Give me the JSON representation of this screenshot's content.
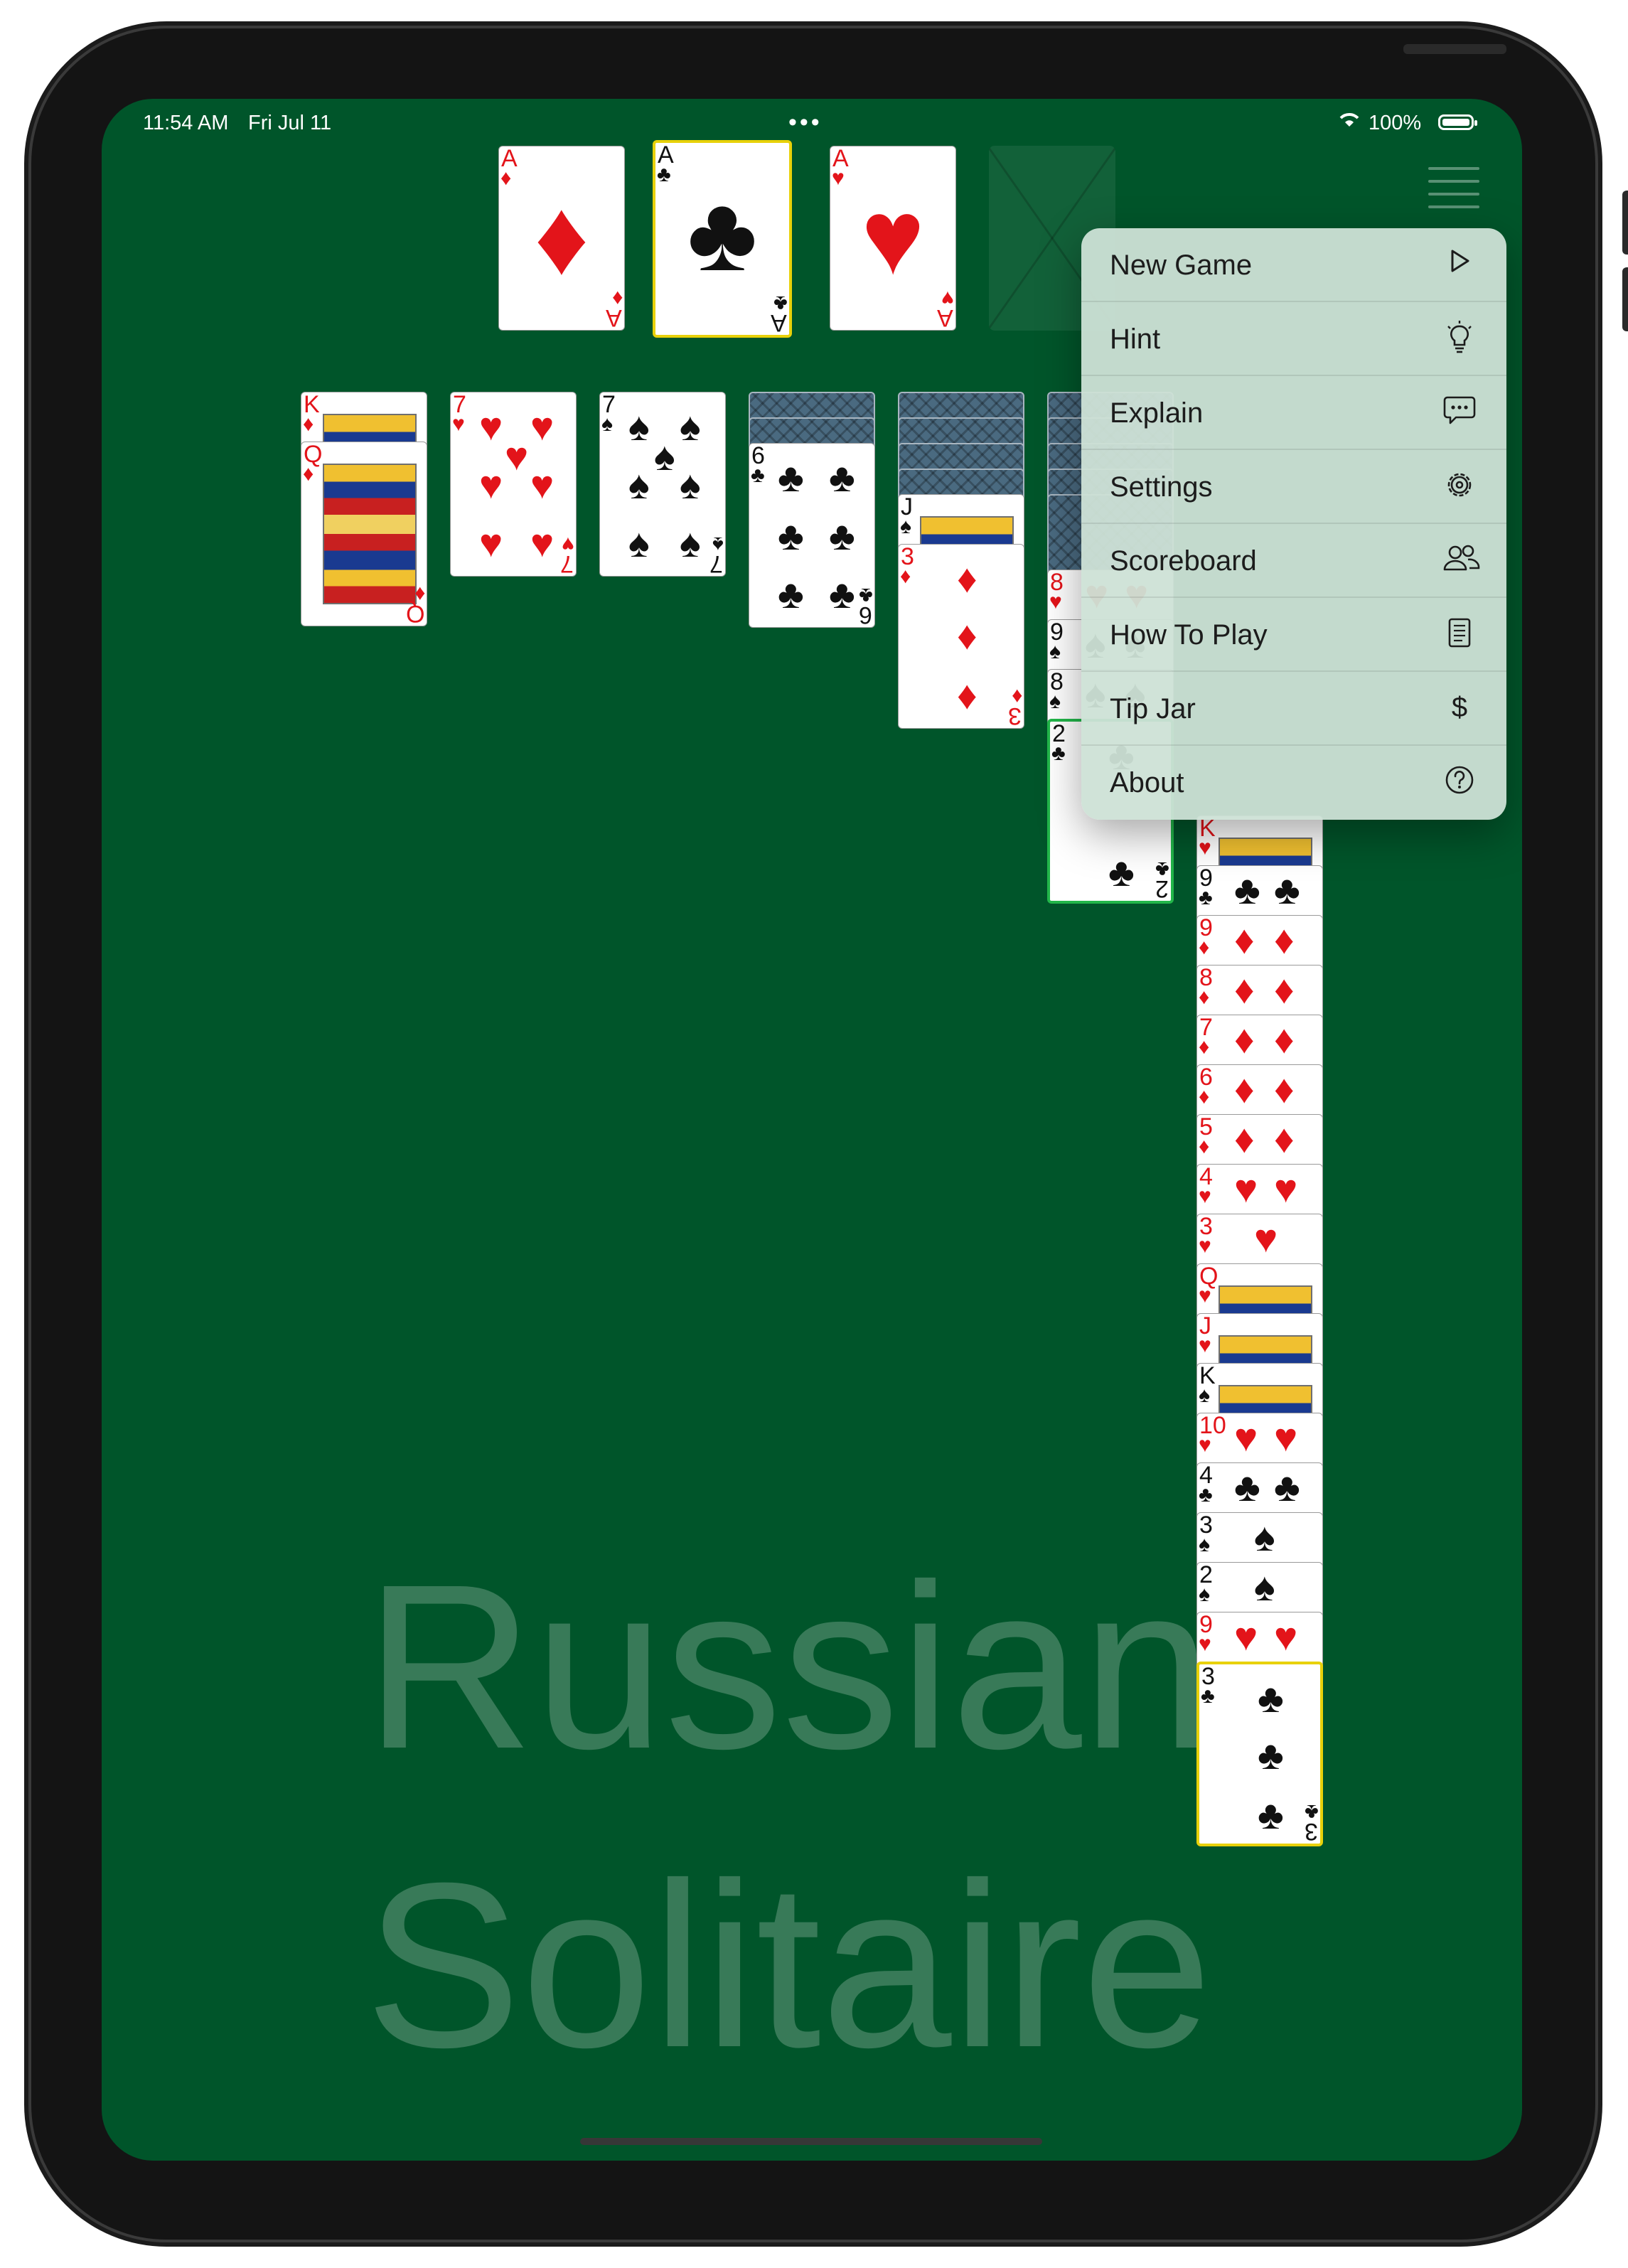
{
  "status_bar": {
    "time": "11:54 AM",
    "date": "Fri Jul 11",
    "multitask_dots": "•••",
    "wifi": "wifi-icon",
    "battery_percent": "100%"
  },
  "watermark": {
    "line1": "Russian",
    "line2": "Solitaire"
  },
  "colors": {
    "felt": "#00552a",
    "red_suit": "#e3141a",
    "black_suit": "#111111",
    "selection_yellow": "#e8d10a",
    "selection_green": "#22b64a"
  },
  "foundations": [
    {
      "rank": "A",
      "suit": "♦"
    },
    {
      "rank": "A",
      "suit": "♣"
    },
    {
      "rank": "A",
      "suit": "♥"
    },
    {
      "rank": "",
      "suit": ""
    }
  ],
  "tableau": [
    {
      "cards": [
        {
          "rank": "K",
          "suit": "♦"
        },
        {
          "rank": "Q",
          "suit": "♦"
        }
      ]
    },
    {
      "cards": [
        {
          "rank": "7",
          "suit": "♥"
        }
      ]
    },
    {
      "cards": [
        {
          "rank": "7",
          "suit": "♠"
        }
      ]
    },
    {
      "cards": [
        {
          "rank": "6",
          "suit": "♣"
        }
      ]
    },
    {
      "cards": [
        {
          "rank": "J",
          "suit": "♠"
        },
        {
          "rank": "3",
          "suit": "♦"
        }
      ]
    },
    {
      "cards": [
        {
          "rank": "8",
          "suit": "♥"
        },
        {
          "rank": "9",
          "suit": "♠"
        },
        {
          "rank": "8",
          "suit": "♠"
        },
        {
          "rank": "2",
          "suit": "♣"
        }
      ]
    },
    {
      "cards": [
        {
          "rank": "K",
          "suit": "♥"
        },
        {
          "rank": "9",
          "suit": "♣"
        },
        {
          "rank": "9",
          "suit": "♦"
        },
        {
          "rank": "8",
          "suit": "♦"
        },
        {
          "rank": "7",
          "suit": "♦"
        },
        {
          "rank": "6",
          "suit": "♦"
        },
        {
          "rank": "5",
          "suit": "♦"
        },
        {
          "rank": "4",
          "suit": "♥"
        },
        {
          "rank": "3",
          "suit": "♥"
        },
        {
          "rank": "Q",
          "suit": "♥"
        },
        {
          "rank": "J",
          "suit": "♥"
        },
        {
          "rank": "K",
          "suit": "♠"
        },
        {
          "rank": "10",
          "suit": "♥"
        },
        {
          "rank": "4",
          "suit": "♣"
        },
        {
          "rank": "3",
          "suit": "♠"
        },
        {
          "rank": "2",
          "suit": "♠"
        },
        {
          "rank": "9",
          "suit": "♥"
        },
        {
          "rank": "3",
          "suit": "♣"
        }
      ]
    }
  ],
  "menu": {
    "items": [
      {
        "label": "New Game",
        "icon": "play-icon"
      },
      {
        "label": "Hint",
        "icon": "lightbulb-icon"
      },
      {
        "label": "Explain",
        "icon": "speech-bubble-icon"
      },
      {
        "label": "Settings",
        "icon": "gear-icon"
      },
      {
        "label": "Scoreboard",
        "icon": "people-icon"
      },
      {
        "label": "How To Play",
        "icon": "book-icon"
      },
      {
        "label": "Tip Jar",
        "icon": "dollar-icon"
      },
      {
        "label": "About",
        "icon": "question-circle-icon"
      }
    ]
  }
}
